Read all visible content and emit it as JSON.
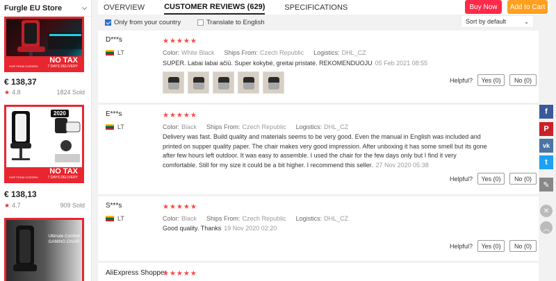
{
  "sidebar": {
    "store_name": "Furgle EU Store",
    "products": [
      {
        "price": "€ 138,37",
        "rating": "4.8",
        "sold": "1824 Sold",
        "banner_big": "NO TAX",
        "banner_small": "7 DAYS DELIVERY",
        "ship_label": "SHIP FROM CZ/ES/RU"
      },
      {
        "price": "€ 138,13",
        "rating": "4.7",
        "sold": "909 Sold",
        "banner_big": "NO TAX",
        "banner_small": "7 DAYS DELIVERY",
        "ship_label": "SHIP FROM CZ/ES/RU",
        "badge": "2020"
      },
      {
        "overlay_text": "Ultimate Comfort GAMING CHAIR"
      }
    ]
  },
  "header": {
    "tabs": [
      "OVERVIEW",
      "CUSTOMER REVIEWS (629)",
      "SPECIFICATIONS"
    ],
    "buy_now": "Buy Now",
    "add_to_cart": "Add to Cart"
  },
  "filters": {
    "only_country": "Only from your country",
    "translate": "Translate to English",
    "sort": "Sort by default"
  },
  "reviews": [
    {
      "name": "D***s",
      "country": "LT",
      "stars": "★★★★★",
      "color_label": "Color:",
      "color": "White Black",
      "ships_label": "Ships From:",
      "ships": "Czech Republic",
      "logistics_label": "Logistics:",
      "logistics": "DHL_CZ",
      "text": "SUPER. Labai labai ačiū. Super kokybė, greitai pristatė. REKOMENDUOJU",
      "date": "05 Feb 2021 08:55",
      "helpful": "Helpful?",
      "yes": "Yes (0)",
      "no": "No (0)"
    },
    {
      "name": "E***s",
      "country": "LT",
      "stars": "★★★★★",
      "color_label": "Color:",
      "color": "Black",
      "ships_label": "Ships From:",
      "ships": "Czech Republic",
      "logistics_label": "Logistics:",
      "logistics": "DHL_CZ",
      "text": "Delivery was fast. Build quality and materials seems to be very good. Even the manual in English was included and printed on supper quality paper. The chair makes very good impression. After unboxing it has some smell but its gone after few hours left outdoor. It was easy to assemble. I used the chair for the few days only but I find it very comfortable. Still for my size it could be a bit higher. I recommend this seller.",
      "date": "27 Nov 2020 05:38",
      "helpful": "Helpful?",
      "yes": "Yes (0)",
      "no": "No (0)"
    },
    {
      "name": "S***s",
      "country": "LT",
      "stars": "★★★★★",
      "color_label": "Color:",
      "color": "Black",
      "ships_label": "Ships From:",
      "ships": "Czech Republic",
      "logistics_label": "Logistics:",
      "logistics": "DHL_CZ",
      "text": "Good quality. Thanks",
      "date": "19 Nov 2020 02:20",
      "helpful": "Helpful?",
      "yes": "Yes (0)",
      "no": "No (0)"
    },
    {
      "name": "AliExpress Shopper",
      "stars": "★★★★★"
    }
  ],
  "social": [
    {
      "icon": "facebook-icon",
      "glyph": "f",
      "color": "#3b5998"
    },
    {
      "icon": "pinterest-icon",
      "glyph": "P",
      "color": "#cb2027"
    },
    {
      "icon": "vk-icon",
      "glyph": "vk",
      "color": "#4c75a3"
    },
    {
      "icon": "twitter-icon",
      "glyph": "t",
      "color": "#1da1f2"
    },
    {
      "icon": "edit-icon",
      "glyph": "✎",
      "color": "#888888"
    }
  ],
  "floating": [
    {
      "icon": "close-icon",
      "glyph": "✕"
    },
    {
      "icon": "scroll-top-icon",
      "glyph": "︿"
    }
  ],
  "colors": {
    "buy_now": "#ff2a4a",
    "add_to_cart": "#ffa021",
    "star": "#ff4444",
    "banner": "#e8262f"
  }
}
